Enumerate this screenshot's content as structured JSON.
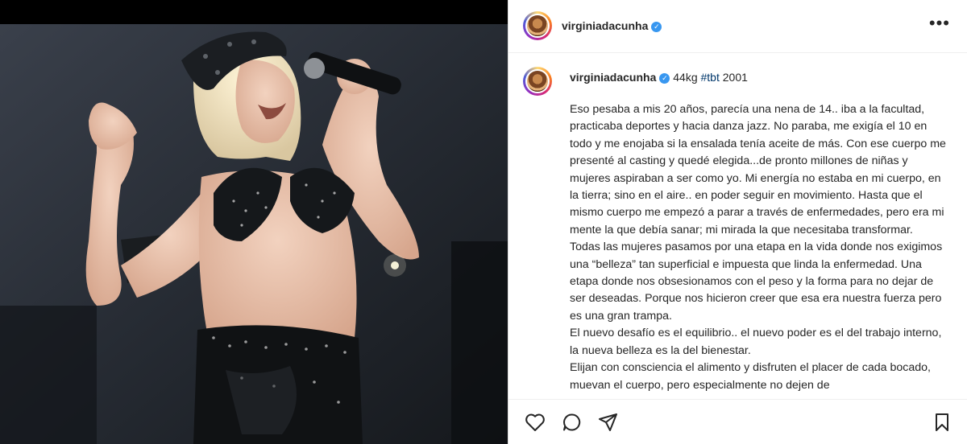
{
  "post": {
    "username": "virginiadacunha",
    "verified_icon": "verified-badge-icon",
    "caption_lead": "44kg",
    "caption_hashtag": "#tbt",
    "caption_year": "2001",
    "caption_body": "Eso pesaba a mis 20 años, parecía una nena de 14.. iba a la facultad, practicaba deportes y hacia danza jazz. No paraba, me exigía el 10 en todo y me enojaba si la ensalada tenía aceite de más. Con ese cuerpo me presenté al casting y quedé elegida...de pronto millones de niñas y mujeres aspiraban a ser como yo. Mi energía no estaba en mi cuerpo, en la tierra; sino en el aire.. en poder seguir en movimiento. Hasta que el mismo cuerpo me empezó a parar a través de enfermedades, pero era mi mente la que debía sanar; mi mirada la que necesitaba transformar.\nTodas las mujeres pasamos por una etapa en la vida donde nos exigimos una “belleza” tan superficial e impuesta que linda la enfermedad. Una etapa donde nos obsesionamos con el peso y la forma para no dejar de ser deseadas. Porque nos hicieron creer que esa era nuestra fuerza pero es una gran trampa.\nEl nuevo desafío es el equilibrio.. el nuevo poder es el del trabajo interno, la nueva belleza es la del bienestar.\nElijan con consciencia el alimento y disfruten el placer de cada bocado, muevan el cuerpo, pero especialmente no dejen de"
  },
  "icons": {
    "more": "more-options-icon",
    "like": "heart-icon",
    "comment": "comment-icon",
    "share": "share-icon",
    "save": "bookmark-icon"
  },
  "colors": {
    "verified": "#3897f0",
    "hashtag": "#00376b",
    "text": "#262626"
  }
}
